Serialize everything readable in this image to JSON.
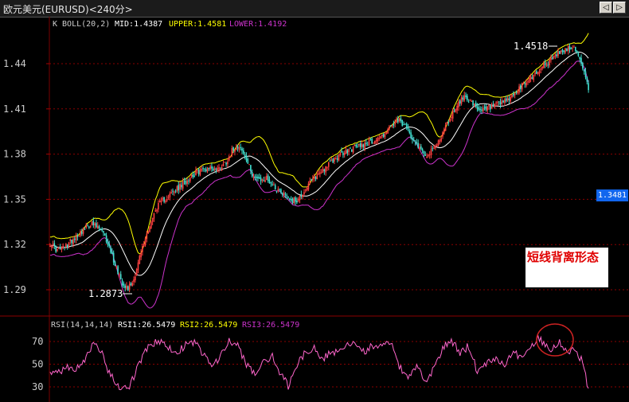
{
  "window": {
    "title": "欧元美元(EURUSD)<240分>",
    "buttons": [
      "◁",
      "▷"
    ]
  },
  "colors": {
    "background": "#000000",
    "grid": "#8b0000",
    "up_candle": "#ff4040",
    "down_candle": "#40e0d0",
    "mid": "#ffffff",
    "upper": "#ffff00",
    "lower": "#cc33cc",
    "rsi": "#ff66cc"
  },
  "main_panel": {
    "indicator_name": "K  BOLL(20,2)",
    "mid_label": "MID:1.4387",
    "upper_label": "UPPER:1.4581",
    "lower_label": "LOWER:1.4192",
    "annotations": [
      "1.4518",
      "1.2873"
    ],
    "current_price": "1.3481",
    "signal_text": "短线背离形态"
  },
  "rsi_panel": {
    "indicator_name": "RSI(14,14,14)",
    "rsi1_label": "RSI1:26.5479",
    "rsi2_label": "RSI2:26.5479",
    "rsi3_label": "RSI3:26.5479"
  },
  "chart_data": [
    {
      "type": "candlestick",
      "ylim": [
        1.275,
        1.47
      ],
      "y_ticks": [
        "1.44",
        "1.41",
        "1.38",
        "1.35",
        "1.32",
        "1.29"
      ],
      "grid": true,
      "close_path": [
        [
          0,
          1.321
        ],
        [
          5,
          1.316
        ],
        [
          10,
          1.318
        ],
        [
          16,
          1.324
        ],
        [
          22,
          1.329
        ],
        [
          28,
          1.334
        ],
        [
          35,
          1.33
        ],
        [
          40,
          1.321
        ],
        [
          45,
          1.307
        ],
        [
          50,
          1.295
        ],
        [
          54,
          1.291
        ],
        [
          58,
          1.297
        ],
        [
          63,
          1.315
        ],
        [
          68,
          1.33
        ],
        [
          74,
          1.345
        ],
        [
          80,
          1.351
        ],
        [
          86,
          1.355
        ],
        [
          92,
          1.36
        ],
        [
          98,
          1.366
        ],
        [
          104,
          1.369
        ],
        [
          110,
          1.371
        ],
        [
          116,
          1.37
        ],
        [
          122,
          1.375
        ],
        [
          127,
          1.384
        ],
        [
          131,
          1.386
        ],
        [
          135,
          1.378
        ],
        [
          140,
          1.367
        ],
        [
          145,
          1.362
        ],
        [
          150,
          1.364
        ],
        [
          156,
          1.358
        ],
        [
          162,
          1.354
        ],
        [
          168,
          1.349
        ],
        [
          172,
          1.35
        ],
        [
          177,
          1.357
        ],
        [
          182,
          1.363
        ],
        [
          188,
          1.369
        ],
        [
          194,
          1.374
        ],
        [
          200,
          1.379
        ],
        [
          206,
          1.382
        ],
        [
          212,
          1.385
        ],
        [
          218,
          1.387
        ],
        [
          224,
          1.389
        ],
        [
          230,
          1.392
        ],
        [
          236,
          1.398
        ],
        [
          242,
          1.402
        ],
        [
          247,
          1.397
        ],
        [
          252,
          1.39
        ],
        [
          257,
          1.383
        ],
        [
          262,
          1.379
        ],
        [
          267,
          1.385
        ],
        [
          272,
          1.394
        ],
        [
          277,
          1.404
        ],
        [
          282,
          1.413
        ],
        [
          288,
          1.419
        ],
        [
          292,
          1.414
        ],
        [
          297,
          1.408
        ],
        [
          302,
          1.41
        ],
        [
          308,
          1.412
        ],
        [
          314,
          1.414
        ],
        [
          320,
          1.418
        ],
        [
          326,
          1.424
        ],
        [
          332,
          1.43
        ],
        [
          337,
          1.434
        ],
        [
          342,
          1.439
        ],
        [
          347,
          1.442
        ],
        [
          352,
          1.447
        ],
        [
          356,
          1.448
        ],
        [
          360,
          1.451
        ],
        [
          364,
          1.449
        ],
        [
          368,
          1.441
        ],
        [
          371,
          1.43
        ],
        [
          373,
          1.423
        ]
      ],
      "labels": {
        "high": "1.4518",
        "low": "1.2873",
        "current": "1.3481"
      }
    },
    {
      "type": "line",
      "name": "RSI",
      "ylim": [
        20,
        80
      ],
      "y_ticks": [
        "70",
        "50",
        "30"
      ],
      "values": [
        [
          0,
          40
        ],
        [
          6,
          44
        ],
        [
          12,
          47
        ],
        [
          18,
          45
        ],
        [
          24,
          55
        ],
        [
          30,
          67
        ],
        [
          36,
          60
        ],
        [
          40,
          45
        ],
        [
          45,
          33
        ],
        [
          50,
          26
        ],
        [
          55,
          31
        ],
        [
          60,
          45
        ],
        [
          65,
          60
        ],
        [
          70,
          67
        ],
        [
          76,
          71
        ],
        [
          82,
          64
        ],
        [
          88,
          61
        ],
        [
          94,
          67
        ],
        [
          100,
          70
        ],
        [
          106,
          58
        ],
        [
          112,
          49
        ],
        [
          118,
          57
        ],
        [
          124,
          70
        ],
        [
          130,
          66
        ],
        [
          136,
          49
        ],
        [
          142,
          42
        ],
        [
          148,
          51
        ],
        [
          154,
          57
        ],
        [
          160,
          40
        ],
        [
          165,
          31
        ],
        [
          170,
          45
        ],
        [
          176,
          60
        ],
        [
          182,
          65
        ],
        [
          188,
          55
        ],
        [
          194,
          59
        ],
        [
          200,
          62
        ],
        [
          206,
          66
        ],
        [
          212,
          69
        ],
        [
          218,
          60
        ],
        [
          224,
          67
        ],
        [
          230,
          64
        ],
        [
          236,
          70
        ],
        [
          242,
          48
        ],
        [
          248,
          36
        ],
        [
          254,
          50
        ],
        [
          260,
          33
        ],
        [
          266,
          46
        ],
        [
          272,
          64
        ],
        [
          278,
          71
        ],
        [
          284,
          60
        ],
        [
          290,
          66
        ],
        [
          296,
          44
        ],
        [
          302,
          51
        ],
        [
          308,
          56
        ],
        [
          314,
          49
        ],
        [
          320,
          60
        ],
        [
          326,
          57
        ],
        [
          332,
          63
        ],
        [
          338,
          74
        ],
        [
          343,
          68
        ],
        [
          348,
          63
        ],
        [
          353,
          70
        ],
        [
          358,
          62
        ],
        [
          363,
          62
        ],
        [
          368,
          55
        ],
        [
          373,
          28
        ]
      ]
    }
  ]
}
